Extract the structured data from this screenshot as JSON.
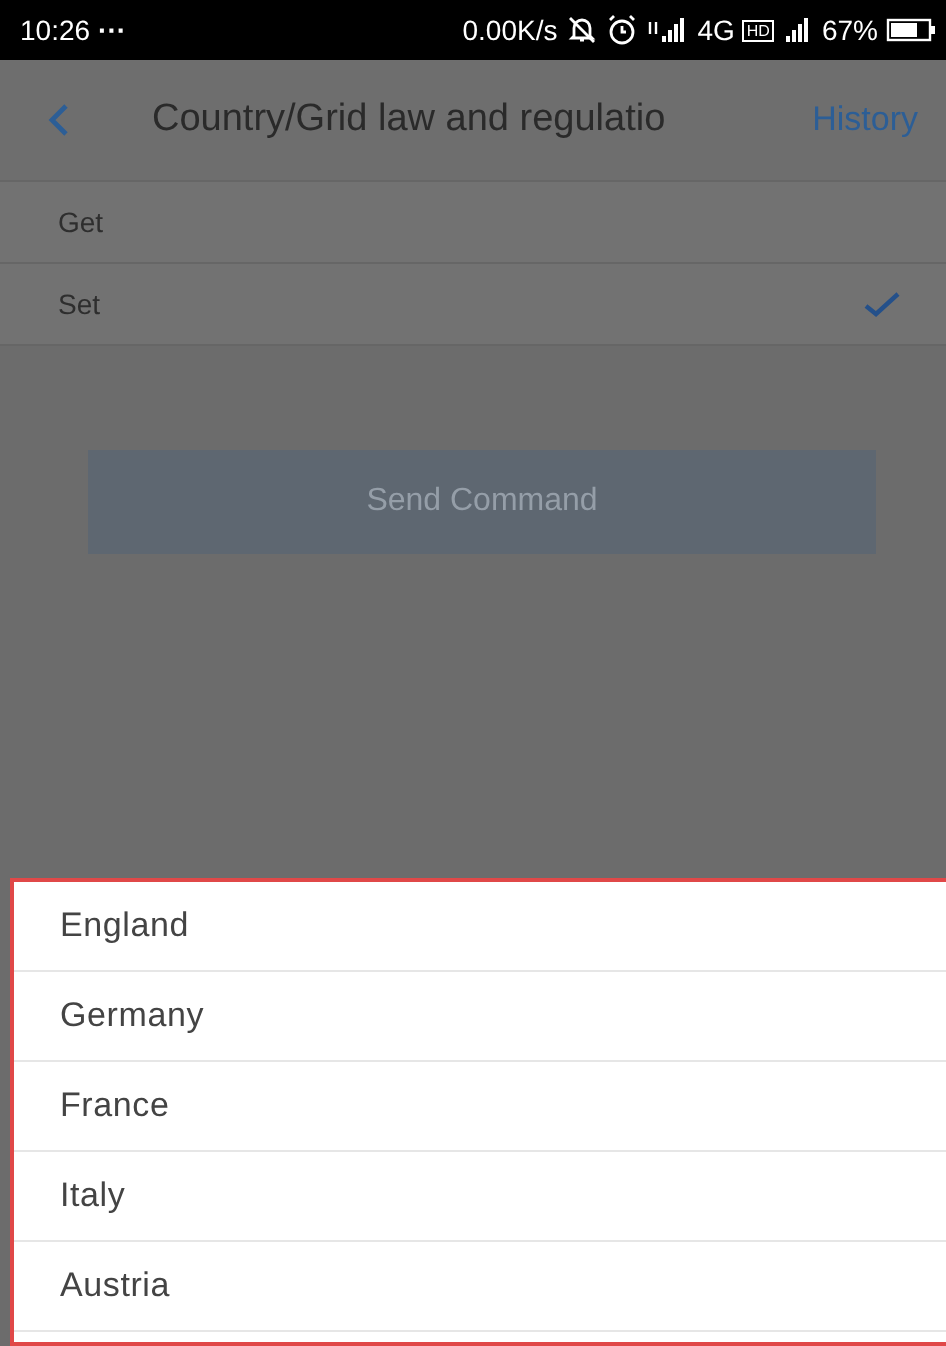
{
  "status_bar": {
    "time": "10:26",
    "dots": "···",
    "speed": "0.00K/s",
    "network": "4G",
    "hd": "HD",
    "battery": "67%"
  },
  "header": {
    "title": "Country/Grid law and regulatio",
    "action": "History"
  },
  "options": [
    {
      "label": "Get",
      "selected": false
    },
    {
      "label": "Set",
      "selected": true
    }
  ],
  "send_button": {
    "label": "Send Command",
    "disabled": true
  },
  "picker": {
    "items": [
      "England",
      "Germany",
      "France",
      "Italy",
      "Austria"
    ]
  }
}
